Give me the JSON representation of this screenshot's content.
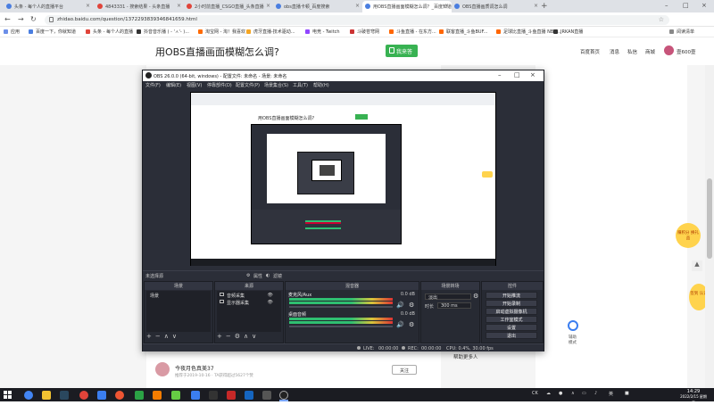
{
  "browser": {
    "tabs": [
      {
        "label": "头条 - 每个人的直播平台"
      },
      {
        "label": "4843331 - 搜索结果 - 头条直播"
      },
      {
        "label": "2小时前直播_CSGO直播_头条直播"
      },
      {
        "label": "obs直播卡顿_百度搜索"
      },
      {
        "label": "用OBS直播画面模糊怎么调？_百度知道"
      },
      {
        "label": "OBS直播画质调怎么调"
      }
    ],
    "url": "zhidao.baidu.com/question/1372293839346841659.html",
    "bookmarks": [
      "应用",
      "百度一下，你就知道",
      "头条 - 每个人的直播",
      "抖音音乐播 ( - 'ㅅ'- )...",
      "淘宝网 - 淘！我喜欢",
      "虎牙直播-技术驱动...",
      "电竞 - Twitch",
      "斗破苍穹网",
      "斗鱼直播 - 在东方...",
      "联客直播_斗鱼BUF...",
      "足球比直播_斗鱼直播 NBA...",
      "JRKAN直播"
    ],
    "reading_list": "阅读清单"
  },
  "page": {
    "question_title": "用OBS直播画面模糊怎么调?",
    "answer_button": "我来答",
    "header_links": [
      "百度首页",
      "消息",
      "私信",
      "商城"
    ],
    "user_name": "壹600壹",
    "help_link": "帮助更多人",
    "answer_user": "今夜月色真美37",
    "answer_meta": "推荐于2019-10-16 · TA获得超过5627个赞",
    "follow_label": "关注",
    "float_badge_1": "赚积分 换礼品",
    "float_badge_2": "签到 认证",
    "help_text": "辅助模式"
  },
  "obs": {
    "title": "OBS 26.0.0 (64-bit, windows) - 配置文件: 未命名 - 场景: 未命名",
    "menu": [
      "文件(F)",
      "编辑(E)",
      "视图(V)",
      "停靠部件(D)",
      "配置文件(P)",
      "场景集合(S)",
      "工具(T)",
      "帮助(H)"
    ],
    "context_no_source": "未选择源",
    "context_properties": "属性",
    "context_filters": "滤镜",
    "nested_question": "用OBS直播画面模糊怎么调?",
    "docks": {
      "scenes": "场景",
      "sources": "来源",
      "mixer": "混音器",
      "transitions": "场景转场",
      "controls": "控件"
    },
    "scene_list": [
      "场景"
    ],
    "source_list": [
      {
        "label": "音频采集"
      },
      {
        "label": "显示器采集"
      }
    ],
    "mixer_channels": [
      {
        "label": "麦克风/Aux",
        "db": "0.0 dB",
        "level": 0.0
      },
      {
        "label": "桌面音频",
        "db": "0.0 dB",
        "level": 0.0
      }
    ],
    "transition": {
      "type": "淡出",
      "duration_label": "时长",
      "duration": "300 ms"
    },
    "controls": [
      "开始推流",
      "开始录制",
      "启动虚拟摄像机",
      "工作室模式",
      "设置",
      "退出"
    ],
    "status": {
      "live_label": "LIVE:",
      "live_time": "00:00:00",
      "rec_label": "REC:",
      "rec_time": "00:00:00",
      "cpu": "CPU: 0.4%, 30.00 fps"
    }
  },
  "taskbar": {
    "time": "14:29",
    "date": "2022/2/15 星期二",
    "tray_lang": "英"
  },
  "colors": {
    "accent_green": "#38b252",
    "obs_bg": "#2b2e38",
    "taskbar_bg": "#1b1c22"
  }
}
